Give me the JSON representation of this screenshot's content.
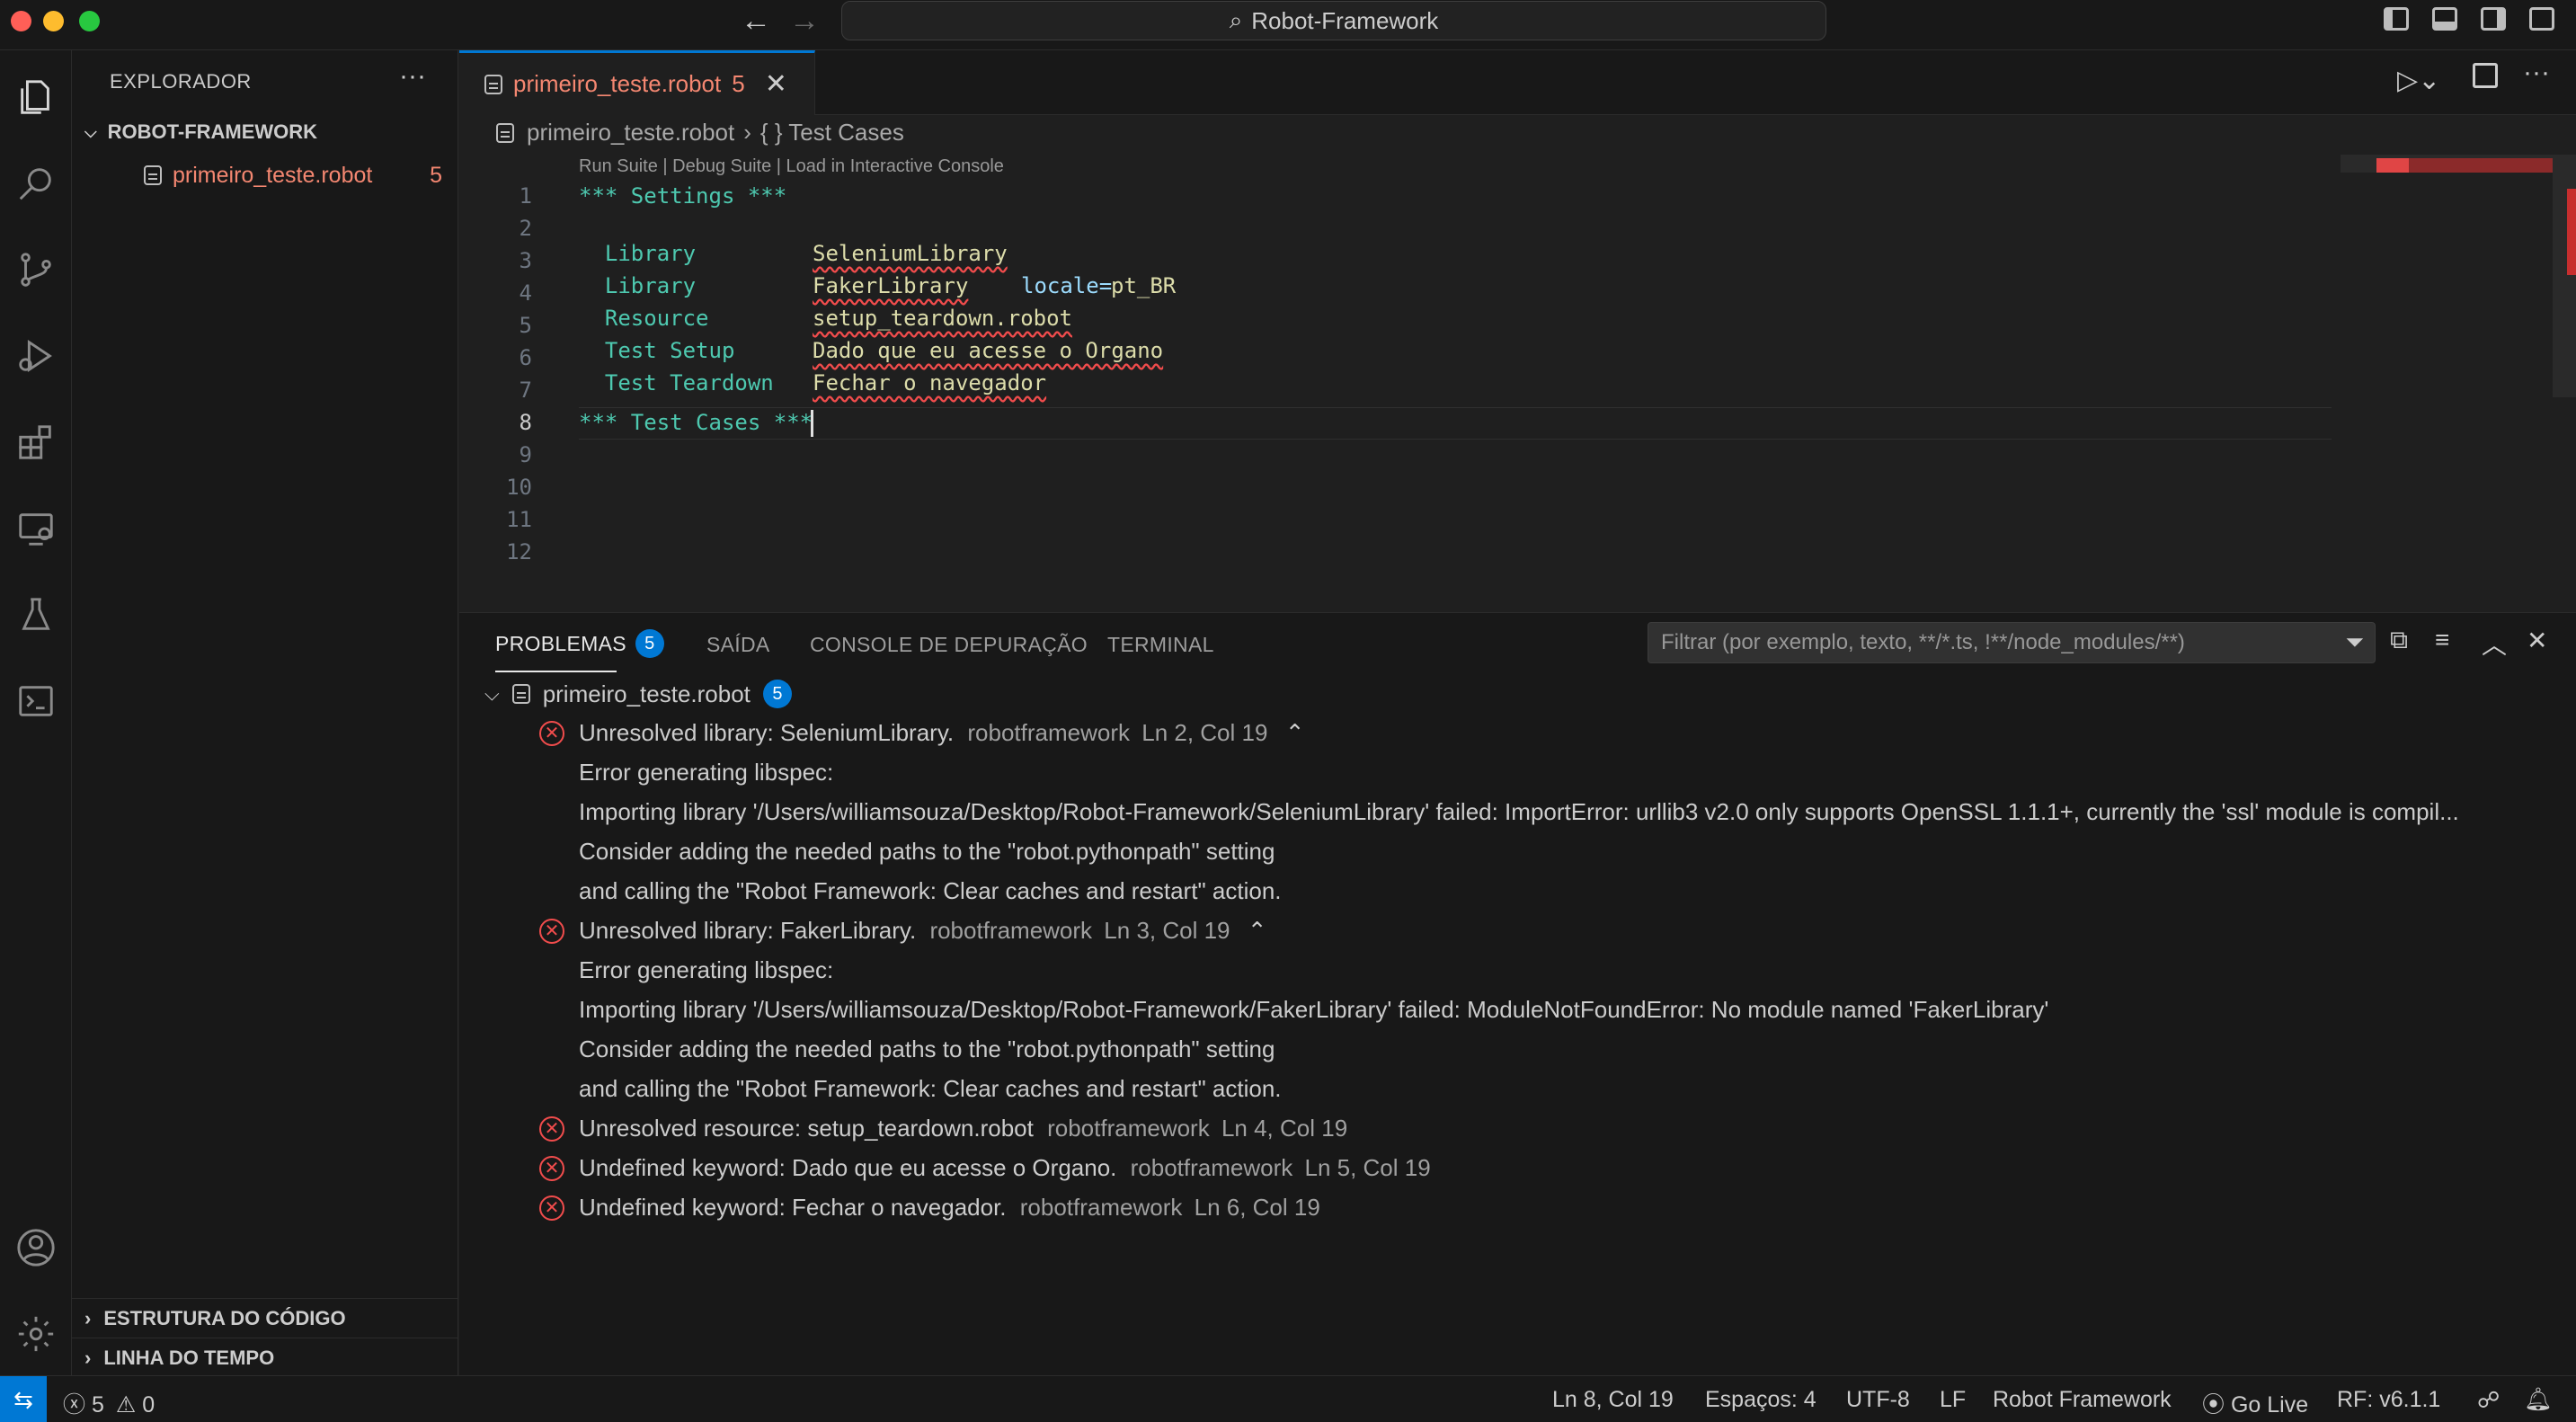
{
  "window": {
    "title": "Robot-Framework"
  },
  "sidebar": {
    "title": "EXPLORADOR",
    "folder": "ROBOT-FRAMEWORK",
    "file": {
      "name": "primeiro_teste.robot",
      "problems": "5"
    },
    "outline": "ESTRUTURA DO CÓDIGO",
    "timeline": "LINHA DO TEMPO"
  },
  "editor": {
    "tab": {
      "name": "primeiro_teste.robot",
      "problems": "5"
    },
    "breadcrumb": {
      "file": "primeiro_teste.robot",
      "symbol": "{ } Test Cases"
    },
    "codelens": "Run Suite | Debug Suite | Load in Interactive Console",
    "lines": [
      "1",
      "2",
      "3",
      "4",
      "5",
      "6",
      "7",
      "8",
      "9",
      "10",
      "11",
      "12"
    ],
    "code": {
      "l1": "*** Settings ***",
      "l2_key": "Library",
      "l2_val": "SeleniumLibrary",
      "l3_key": "Library",
      "l3_val": "FakerLibrary",
      "l3_param": "locale=",
      "l3_param_val": "pt_BR",
      "l4_key": "Resource",
      "l4_val": "setup_teardown.robot",
      "l5_key": "Test Setup",
      "l5_val": "Dado que eu acesse o Organo",
      "l6_key": "Test Teardown",
      "l6_val": "Fechar o navegador",
      "l8": "*** Test Cases ***"
    }
  },
  "panel": {
    "tabs": {
      "problems": "PROBLEMAS",
      "problems_count": "5",
      "output": "SAÍDA",
      "debug": "CONSOLE DE DEPURAÇÃO",
      "terminal": "TERMINAL"
    },
    "filter_placeholder": "Filtrar (por exemplo, texto, **/*.ts, !**/node_modules/**)",
    "group": {
      "file": "primeiro_teste.robot",
      "count": "5"
    },
    "problems": [
      {
        "message": "Unresolved library: SeleniumLibrary.",
        "source": "robotframework",
        "location": "Ln 2, Col 19",
        "details": [
          "Error generating libspec:",
          "Importing library '/Users/williamsouza/Desktop/Robot-Framework/SeleniumLibrary' failed: ImportError: urllib3 v2.0 only supports OpenSSL 1.1.1+, currently the 'ssl' module is compil...",
          "Consider adding the needed paths to the \"robot.pythonpath\" setting",
          "and calling the \"Robot Framework: Clear caches and restart\" action."
        ]
      },
      {
        "message": "Unresolved library: FakerLibrary.",
        "source": "robotframework",
        "location": "Ln 3, Col 19",
        "details": [
          "Error generating libspec:",
          "Importing library '/Users/williamsouza/Desktop/Robot-Framework/FakerLibrary' failed: ModuleNotFoundError: No module named 'FakerLibrary'",
          "Consider adding the needed paths to the \"robot.pythonpath\" setting",
          "and calling the \"Robot Framework: Clear caches and restart\" action."
        ]
      },
      {
        "message": "Unresolved resource: setup_teardown.robot",
        "source": "robotframework",
        "location": "Ln 4, Col 19"
      },
      {
        "message": "Undefined keyword: Dado que eu acesse o Organo.",
        "source": "robotframework",
        "location": "Ln 5, Col 19"
      },
      {
        "message": "Undefined keyword: Fechar o navegador.",
        "source": "robotframework",
        "location": "Ln 6, Col 19"
      }
    ]
  },
  "statusbar": {
    "errors": "5",
    "warnings": "0",
    "position": "Ln 8, Col 19",
    "spaces": "Espaços: 4",
    "encoding": "UTF-8",
    "eol": "LF",
    "language": "Robot Framework",
    "golive": "Go Live",
    "rf_version": "RF: v6.1.1"
  },
  "colors": {
    "accent": "#0078d4",
    "error": "#f14c4c",
    "file_error": "#f48771"
  }
}
